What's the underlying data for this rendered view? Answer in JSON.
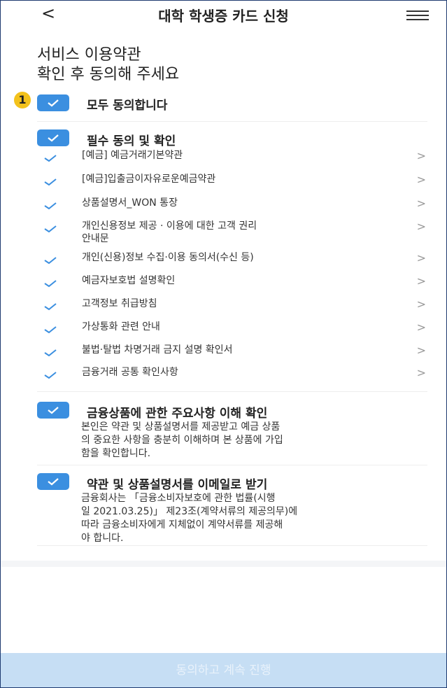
{
  "header": {
    "back_label": "<",
    "title": "대학 학생증 카드 신청"
  },
  "intro": {
    "line1": "서비스 이용약관",
    "line2": "확인 후 동의해 주세요"
  },
  "badge": "1",
  "agree_all": "모두 동의합니다",
  "required_section": {
    "title": "필수 동의 및 확인",
    "items": [
      {
        "label": "[예금] 예금거래기본약관",
        "chevron": ">"
      },
      {
        "label": "[예금]입출금이자유로운예금약관",
        "chevron": ">"
      },
      {
        "label": "상품설명서_WON 통장",
        "chevron": ">"
      },
      {
        "label": "개인신용정보 제공 · 이용에 대한 고객 권리",
        "label2": "안내문",
        "chevron": ">"
      },
      {
        "label": "개인(신용)정보 수집·이용 동의서(수신 등)",
        "chevron": ">"
      },
      {
        "label": "예금자보호법 설명확인",
        "chevron": ">"
      },
      {
        "label": "고객정보 취급방침",
        "chevron": ">"
      },
      {
        "label": "가상통화 관련 안내",
        "chevron": ">"
      },
      {
        "label": "불법·탈법 차명거래 금지 설명 확인서",
        "chevron": ">"
      },
      {
        "label": "금융거래 공통 확인사항",
        "chevron": ">"
      }
    ]
  },
  "product_section": {
    "title": "금융상품에 관한 주요사항 이해 확인",
    "desc1": "본인은 약관 및 상품설명서를 제공받고 예금 상품",
    "desc2": "의 중요한 사항을 충분히 이해하며 본 상품에 가입",
    "desc3": "함을 확인합니다."
  },
  "email_section": {
    "title": "약관 및 상품설명서를 이메일로 받기",
    "desc1": "금융회사는 「금융소비자보호에 관한 법률(시행",
    "desc2": "일 2021.03.25)」 제23조(계약서류의 제공의무)에",
    "desc3": "따라 금융소비자에게 지체없이 계약서류를 제공해",
    "desc4": "야 합니다."
  },
  "cta_label": "동의하고 계속 진행",
  "colors": {
    "accent": "#3b8fe0",
    "badge": "#f3c21c",
    "cta_disabled": "#c6def4"
  }
}
